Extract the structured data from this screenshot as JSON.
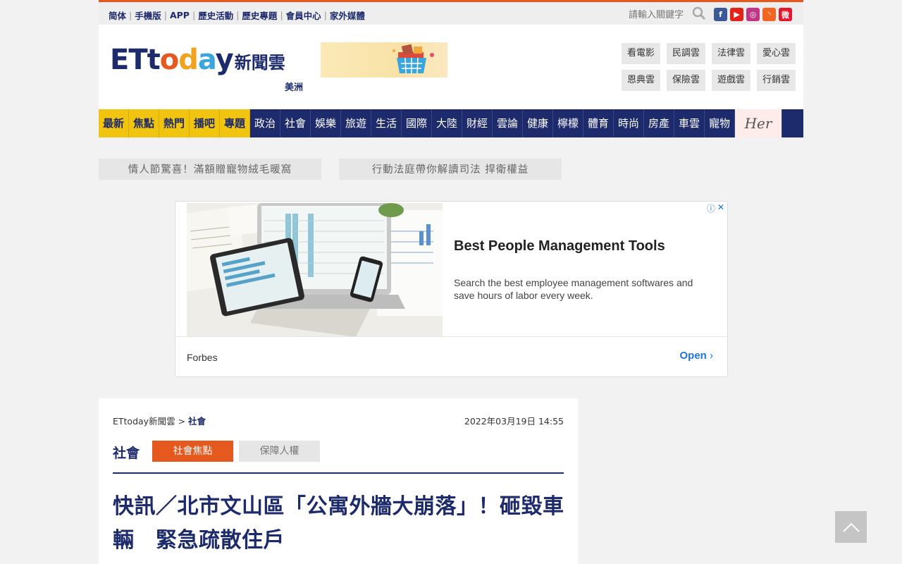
{
  "topbar": {
    "links": [
      "简体",
      "手機版",
      "APP",
      "歷史活動",
      "歷史專題",
      "會員中心",
      "家外媒體"
    ],
    "search_placeholder": "請輸入關鍵字"
  },
  "social": [
    {
      "icon": "facebook-icon",
      "glyph": "f",
      "color": "#3b5998"
    },
    {
      "icon": "youtube-icon",
      "glyph": "▶",
      "color": "#e62117"
    },
    {
      "icon": "instagram-icon",
      "glyph": "◎",
      "color": "#c13584"
    },
    {
      "icon": "rss-icon",
      "glyph": "◝",
      "color": "#f26522"
    },
    {
      "icon": "weibo-icon",
      "glyph": "微",
      "color": "#e6162d"
    }
  ],
  "header": {
    "logo_et": "ETt",
    "logo_oday": "oday",
    "logo_cloud": "新聞雲",
    "region": "美洲",
    "cloud_links": [
      "看電影",
      "民調雲",
      "法律雲",
      "愛心雲",
      "恩典雲",
      "保險雲",
      "遊戲雲",
      "行銷雲"
    ]
  },
  "nav": {
    "highlight_items": [
      "最新",
      "焦點",
      "熱門",
      "播吧",
      "專題"
    ],
    "items": [
      "政治",
      "社會",
      "娛樂",
      "旅遊",
      "生活",
      "國際",
      "大陸",
      "財經",
      "雲論",
      "健康",
      "檸檬",
      "體育",
      "時尚",
      "房產",
      "車雲",
      "寵物"
    ],
    "her_label": "Her"
  },
  "promos": [
    "情人節驚喜！滿額贈寵物絨毛暖窩",
    "行動法庭帶你解讀司法 捍衛權益"
  ],
  "ad": {
    "title": "Best People Management Tools",
    "description": "Search the best employee management softwares and save hours of labor every week.",
    "brand": "Forbes",
    "open_label": "Open",
    "info_glyph": "ⓘ",
    "close_glyph": "✕"
  },
  "article": {
    "breadcrumb_home": "ETtoday新聞雲",
    "breadcrumb_sep": ">",
    "breadcrumb_section": "社會",
    "date": "2022年03月19日 14:55",
    "section": "社會",
    "tags": [
      {
        "label": "社會焦點",
        "bg": "#e5591f",
        "fg": "#ffffff"
      },
      {
        "label": "保障人權",
        "bg": "#e6e6e6",
        "fg": "#777777"
      }
    ],
    "headline": "快訊／北市文山區「公寓外牆大崩落」！砸毀車輛　緊急疏散住戶"
  },
  "colors": {
    "brand_navy": "#1d2a6b",
    "brand_orange": "#e5591f",
    "nav_yellow": "#f1c40f"
  }
}
